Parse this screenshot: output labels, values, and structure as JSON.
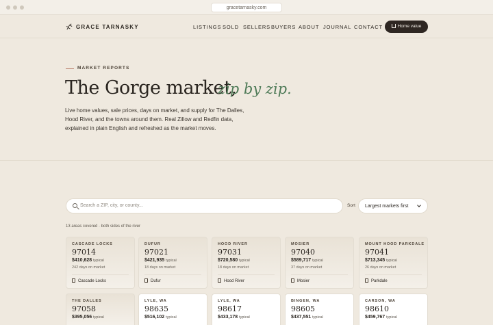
{
  "browser": {
    "url": "gracetarnasky.com"
  },
  "nav": {
    "brand": "GRACE TARNASKY",
    "items": [
      "LISTINGS",
      "SOLD",
      "SELLERS",
      "BUYERS",
      "ABOUT",
      "JOURNAL",
      "CONTACT"
    ],
    "cta": "Home value"
  },
  "hero": {
    "kicker": "MARKET REPORTS",
    "title": "The Gorge market,",
    "script": "zip by zip.",
    "intro": "Live home values, sale prices, days on market, and supply for The Dalles, Hood River, and the towns around them. Real Zillow and Redfin data, explained in plain English and refreshed as the market moves."
  },
  "filters": {
    "search_placeholder": "Search a ZIP, city, or county...",
    "sort_label": "Sort",
    "sort_value": "Largest markets first"
  },
  "summary": "13 areas covered · both sides of the river",
  "cards": [
    {
      "city": "CASCADE LOCKS",
      "zip": "97014",
      "price": "$410,628",
      "typical": "typical",
      "dom": "242 days on market",
      "foot": "Cascade Locks"
    },
    {
      "city": "DUFUR",
      "zip": "97021",
      "price": "$421,935",
      "typical": "typical",
      "dom": "18 days on market",
      "foot": "Dufur"
    },
    {
      "city": "HOOD RIVER",
      "zip": "97031",
      "price": "$720,580",
      "typical": "typical",
      "dom": "18 days on market",
      "foot": "Hood River"
    },
    {
      "city": "MOSIER",
      "zip": "97040",
      "price": "$589,717",
      "typical": "typical",
      "dom": "37 days on market",
      "foot": "Mosier"
    },
    {
      "city": "MOUNT HOOD PARKDALE",
      "zip": "97041",
      "price": "$713,345",
      "typical": "typical",
      "dom": "26 days on market",
      "foot": "Parkdale"
    },
    {
      "city": "THE DALLES",
      "zip": "97058",
      "price": "$395,056",
      "typical": "typical",
      "dom": "",
      "foot": ""
    },
    {
      "city": "LYLE, WA",
      "zip": "98635",
      "price": "$516,102",
      "typical": "typical",
      "dom": "",
      "foot": ""
    },
    {
      "city": "LYLE, WA",
      "zip": "98617",
      "price": "$433,178",
      "typical": "typical",
      "dom": "",
      "foot": ""
    },
    {
      "city": "BINGEN, WA",
      "zip": "98605",
      "price": "$437,551",
      "typical": "typical",
      "dom": "",
      "foot": ""
    },
    {
      "city": "CARSON, WA",
      "zip": "98610",
      "price": "$459,767",
      "typical": "typical",
      "dom": "",
      "foot": ""
    }
  ]
}
